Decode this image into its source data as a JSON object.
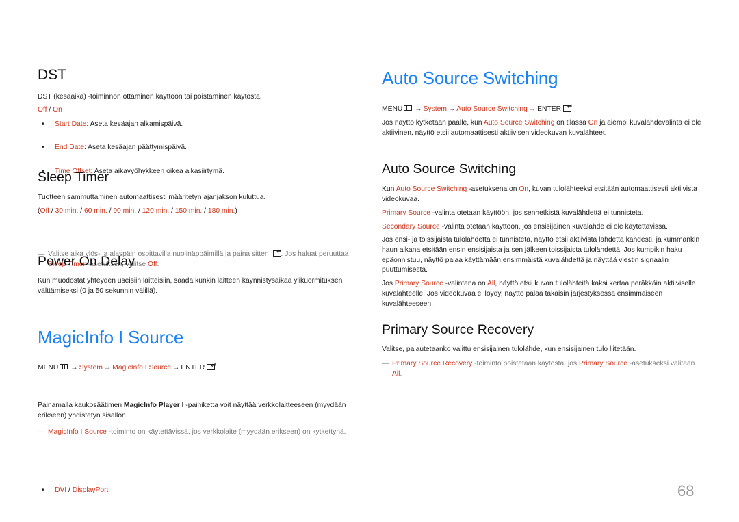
{
  "left": {
    "dst": {
      "title": "DST",
      "description": "DST (kesäaika) -toiminnon ottaminen käyttöön tai poistaminen käytöstä.",
      "options": [
        "Off",
        "On"
      ],
      "option_sep": " / ",
      "bullets": [
        {
          "term": "Start Date",
          "text": ": Aseta kesäajan alkamispäivä."
        },
        {
          "term": "End Date",
          "text": ": Aseta kesäajan päättymispäivä."
        },
        {
          "term": "Time Offset",
          "text": ": Aseta aikavyöhykkeen oikea aikasiirtymä."
        }
      ]
    },
    "sleep_timer": {
      "title": "Sleep Timer",
      "description": "Tuotteen sammuttaminen automaattisesti määritetyn ajanjakson kuluttua.",
      "options": [
        "Off",
        "30 min.",
        "60 min.",
        "90 min.",
        "120 min.",
        "150 min.",
        "180 min."
      ],
      "open_paren": "(",
      "close_paren": ")",
      "sep": " / ",
      "note_dash": "—",
      "note_part1": "Valitse aika ylös- ja alaspäin osoittavilla nuolinäppäimillä ja paina sitten ",
      "note_part2": ". Jos haluat peruuttaa ",
      "note_term": "Sleep Timer",
      "note_part3": " -asetuksen, valitse ",
      "note_value": "Off",
      "note_end": "."
    },
    "power_on_delay": {
      "title": "Power On Delay",
      "description": "Kun muodostat yhteyden useisiin laitteisiin, säädä kunkin laitteen käynnistysaikaa ylikuormituksen välttämiseksi (0 ja 50 sekunnin välillä)."
    },
    "magicinfo": {
      "title": "MagicInfo I Source",
      "path": {
        "menu": "MENU",
        "system": "System",
        "item": "MagicInfo I Source",
        "enter": "ENTER"
      },
      "path_arrow": "→",
      "note_dash": "—",
      "note_term": "MagicInfo I Source",
      "note_text": " -toiminto on käytettävissä, jos verkkolaite (myydään erikseen) on kytkettynä.",
      "desc_part1": "Painamalla kaukosäätimen ",
      "desc_bold": "MagicInfo Player I",
      "desc_part2": " -painiketta voit näyttää verkkolaitteeseen (myydään erikseen) yhdistetyn sisällön.",
      "bullet_options": [
        "DVI",
        "DisplayPort"
      ],
      "bullet_sep": " / "
    }
  },
  "right": {
    "auto_source": {
      "title": "Auto Source Switching",
      "path": {
        "menu": "MENU",
        "system": "System",
        "item": "Auto Source Switching",
        "enter": "ENTER"
      },
      "path_arrow": "→",
      "intro_part1": "Jos näyttö kytketään päälle, kun ",
      "intro_term": "Auto Source Switching",
      "intro_part2": " on tilassa ",
      "intro_value": "On",
      "intro_part3": " ja aiempi kuvalähdevalinta ei ole aktiivinen, näyttö etsii automaattisesti aktiivisen videokuvan kuvalähteet."
    },
    "auto_source_sub": {
      "title": "Auto Source Switching",
      "p1_part1": "Kun ",
      "p1_term": "Auto Source Switching",
      "p1_part2": " -asetuksena on ",
      "p1_value": "On",
      "p1_part3": ", kuvan tulolähteeksi etsitään automaattisesti aktiivista videokuvaa.",
      "p2_term": "Primary Source",
      "p2_text": " -valinta otetaan käyttöön, jos senhetkistä kuvalähdettä ei tunnisteta.",
      "p3_term": "Secondary Source",
      "p3_text": " -valinta otetaan käyttöön, jos ensisijainen kuvalähde ei ole käytettävissä.",
      "p4": "Jos ensi- ja toissijaista tulolähdettä ei tunnisteta, näyttö etsii aktiivista lähdettä kahdesti, ja kummankin haun aikana etsitään ensin ensisijaista ja sen jälkeen toissijaista tulolähdettä. Jos kumpikin haku epäonnistuu, näyttö palaa käyttämään ensimmäistä kuvalähdettä ja näyttää viestin signaalin puuttumisesta.",
      "p5_part1": "Jos ",
      "p5_term": "Primary Source",
      "p5_part2": " -valintana on ",
      "p5_value": "All",
      "p5_part3": ", näyttö etsii kuvan tulolähteitä kaksi kertaa peräkkäin aktiiviselle kuvalähteelle. Jos videokuvaa ei löydy, näyttö palaa takaisin järjestyksessä ensimmäiseen kuvalähteeseen."
    },
    "primary_recovery": {
      "title": "Primary Source Recovery",
      "description": "Valitse, palautetaanko valittu ensisijainen tulolähde, kun ensisijainen tulo liitetään.",
      "note_dash": "—",
      "note_term1": "Primary Source Recovery",
      "note_part1": " -toiminto poistetaan käytöstä, jos ",
      "note_term2": "Primary Source",
      "note_part2": " -asetukseksi valitaan ",
      "note_value": "All",
      "note_end": "."
    }
  },
  "page_number": "68",
  "colors": {
    "heading_blue": "#1a82f5",
    "term_red": "#d0361d",
    "note_gray": "#777777",
    "page_number_gray": "#999999"
  }
}
